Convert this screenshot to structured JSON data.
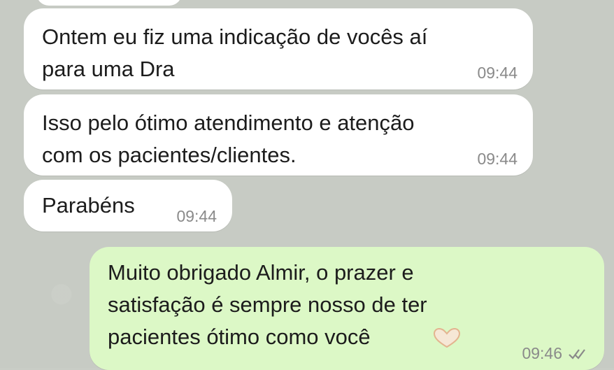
{
  "messages": [
    {
      "id": "msg1",
      "direction": "incoming",
      "text": "Ontem eu fiz uma indicação de vocês aí\npara uma Dra",
      "time": "09:44"
    },
    {
      "id": "msg2",
      "direction": "incoming",
      "text": "Isso pelo ótimo atendimento e atenção\ncom os pacientes/clientes.",
      "time": "09:44"
    },
    {
      "id": "msg3",
      "direction": "incoming",
      "text": "Parabéns",
      "time": "09:44"
    },
    {
      "id": "msg4",
      "direction": "outgoing",
      "text": "Muito obrigado Almir, o prazer e\nsatisfação é sempre nosso de ter\npacientes ótimo como você",
      "time": "09:46",
      "status_icon": "double-check-icon",
      "emoji_icon": "heart-hands-icon"
    }
  ],
  "colors": {
    "incoming_bubble": "#ffffff",
    "outgoing_bubble": "#dcf8c6",
    "background": "#c7cbc4",
    "timestamp": "#8a8a8a"
  }
}
